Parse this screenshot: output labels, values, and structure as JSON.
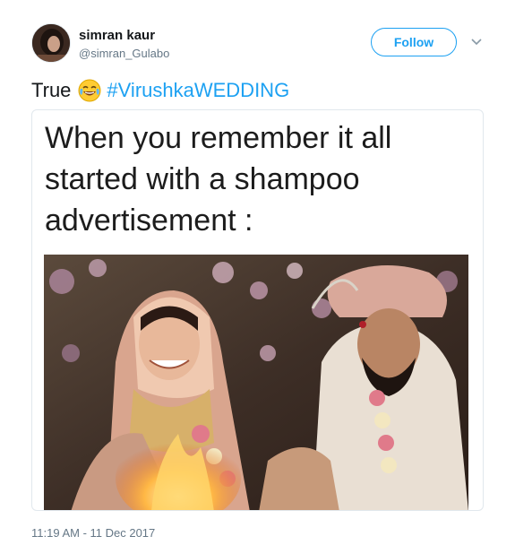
{
  "author": {
    "display_name": "simran kaur",
    "handle": "@simran_Gulabo"
  },
  "follow_button": {
    "label": "Follow"
  },
  "tweet": {
    "text": "True",
    "emoji": "face-with-tears-of-joy",
    "hashtag": "#VirushkaWEDDING"
  },
  "media": {
    "caption": "When you remember it all started with a shampoo advertisement :"
  },
  "timestamp": "11:19 AM - 11 Dec 2017",
  "colors": {
    "accent": "#1da1f2",
    "secondary_text": "#657786",
    "border": "#e1e8ed"
  },
  "icons": {
    "menu": "chevron-down-icon"
  }
}
